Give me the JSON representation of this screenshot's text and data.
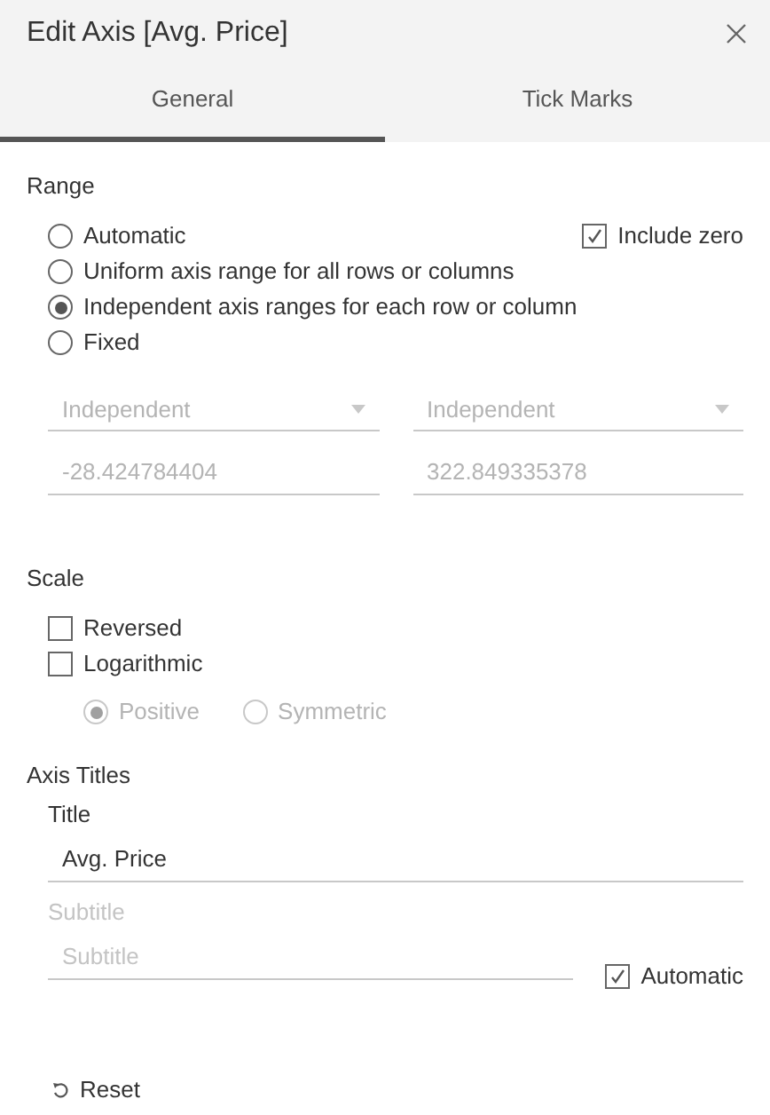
{
  "dialog": {
    "title": "Edit Axis [Avg. Price]"
  },
  "tabs": [
    {
      "label": "General",
      "selected": true
    },
    {
      "label": "Tick Marks",
      "selected": false
    }
  ],
  "range": {
    "heading": "Range",
    "options": [
      {
        "label": "Automatic",
        "selected": false
      },
      {
        "label": "Uniform axis range for all rows or columns",
        "selected": false
      },
      {
        "label": "Independent axis ranges for each row or column",
        "selected": true
      },
      {
        "label": "Fixed",
        "selected": false
      }
    ],
    "include_zero": {
      "label": "Include zero",
      "checked": true
    },
    "dropdowns": [
      {
        "value": "Independent",
        "disabled": true
      },
      {
        "value": "Independent",
        "disabled": true
      }
    ],
    "fields": [
      {
        "value": "-28.424784404",
        "disabled": true
      },
      {
        "value": "322.849335378",
        "disabled": true
      }
    ]
  },
  "scale": {
    "heading": "Scale",
    "checkboxes": [
      {
        "label": "Reversed",
        "checked": false
      },
      {
        "label": "Logarithmic",
        "checked": false
      }
    ],
    "log_options": [
      {
        "label": "Positive",
        "selected": true,
        "disabled": true
      },
      {
        "label": "Symmetric",
        "selected": false,
        "disabled": true
      }
    ]
  },
  "axis_titles": {
    "heading": "Axis Titles",
    "title": {
      "label": "Title",
      "value": "Avg. Price",
      "disabled": false
    },
    "subtitle": {
      "label": "Subtitle",
      "placeholder": "Subtitle",
      "disabled": true
    },
    "automatic": {
      "label": "Automatic",
      "checked": true
    }
  },
  "reset": {
    "label": "Reset"
  }
}
